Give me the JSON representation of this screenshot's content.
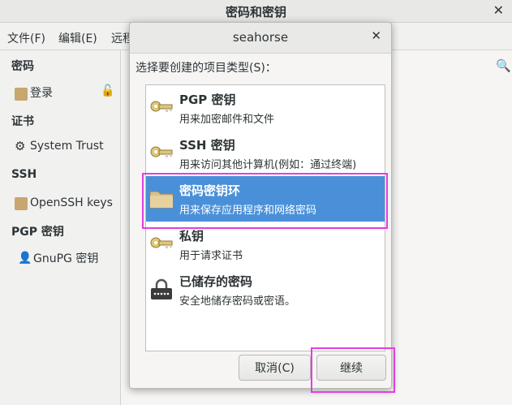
{
  "window": {
    "title": "密码和密钥"
  },
  "menu": [
    "文件(F)",
    "编辑(E)",
    "远程"
  ],
  "sidebar": {
    "sections": [
      {
        "header": "密码",
        "items": [
          {
            "label": "登录",
            "icon": "folder-icon"
          }
        ]
      },
      {
        "header": "证书",
        "items": [
          {
            "label": "System Trust",
            "icon": "gear-icon"
          }
        ]
      },
      {
        "header": "SSH",
        "items": [
          {
            "label": "OpenSSH keys",
            "icon": "folder-icon"
          }
        ]
      },
      {
        "header": "PGP 密钥",
        "items": [
          {
            "label": "GnuPG 密钥",
            "icon": "person-icon"
          }
        ]
      }
    ]
  },
  "dialog": {
    "title": "seahorse",
    "prompt": "选择要创建的项目类型(S)：",
    "options": [
      {
        "name": "PGP 密钥",
        "desc": "用来加密邮件和文件",
        "icon": "key-icon"
      },
      {
        "name": "SSH 密钥",
        "desc": "用来访问其他计算机(例如：通过终端)",
        "icon": "key-icon"
      },
      {
        "name": "密码密钥环",
        "desc": "用来保存应用程序和网络密码",
        "icon": "folder-icon",
        "selected": true
      },
      {
        "name": "私钥",
        "desc": "用于请求证书",
        "icon": "key-icon"
      },
      {
        "name": "已储存的密码",
        "desc": "安全地储存密码或密语。",
        "icon": "lock-icon"
      }
    ],
    "cancel": "取消(C)",
    "continue": "继续"
  },
  "colors": {
    "selection": "#4a90d9",
    "highlight": "#e33ee0"
  }
}
